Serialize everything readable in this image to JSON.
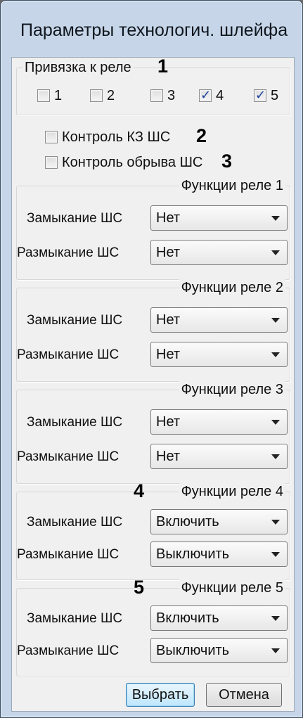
{
  "window": {
    "title": "Параметры технологич. шлейфа"
  },
  "relay_binding": {
    "legend": "Привязка к реле",
    "marker": "1",
    "checkboxes": [
      {
        "label": "1",
        "checked": false
      },
      {
        "label": "2",
        "checked": false
      },
      {
        "label": "3",
        "checked": false
      },
      {
        "label": "4",
        "checked": true
      },
      {
        "label": "5",
        "checked": true
      }
    ]
  },
  "controls": {
    "short_circuit": {
      "label": "Контроль КЗ ШС",
      "checked": false,
      "marker": "2"
    },
    "break": {
      "label": "Контроль обрыва ШС",
      "checked": false,
      "marker": "3"
    }
  },
  "relay_functions": [
    {
      "title": "Функции реле 1",
      "marker": "",
      "close_label": "Замыкание ШС",
      "close_value": "Нет",
      "open_label": "Размыкание ШС",
      "open_value": "Нет"
    },
    {
      "title": "Функции реле 2",
      "marker": "",
      "close_label": "Замыкание ШС",
      "close_value": "Нет",
      "open_label": "Размыкание ШС",
      "open_value": "Нет"
    },
    {
      "title": "Функции реле 3",
      "marker": "",
      "close_label": "Замыкание ШС",
      "close_value": "Нет",
      "open_label": "Размыкание ШС",
      "open_value": "Нет"
    },
    {
      "title": "Функции реле 4",
      "marker": "4",
      "close_label": "Замыкание ШС",
      "close_value": "Включить",
      "open_label": "Размыкание ШС",
      "open_value": "Выключить"
    },
    {
      "title": "Функции реле 5",
      "marker": "5",
      "close_label": "Замыкание ШС",
      "close_value": "Включить",
      "open_label": "Размыкание ШС",
      "open_value": "Выключить"
    }
  ],
  "buttons": {
    "select": "Выбрать",
    "cancel": "Отмена"
  },
  "colors": {
    "check": "#1f3f99",
    "client_bg": "#f0f0f0",
    "frame": "#c6d6e8"
  }
}
